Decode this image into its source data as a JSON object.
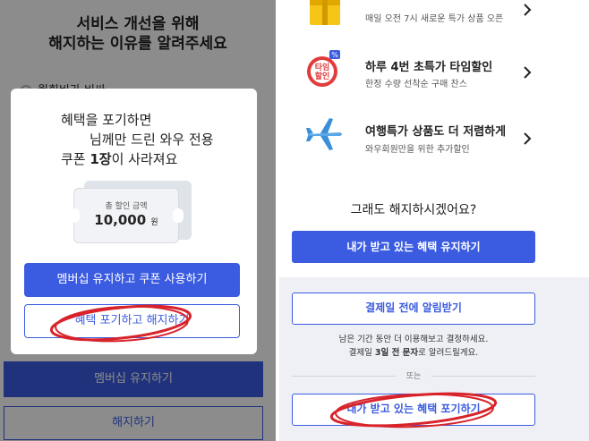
{
  "left": {
    "title_line1": "서비스 개선을 위해",
    "title_line2": "해지하는 이유를 알려주세요",
    "partial_option": "월회비가 비싸",
    "keep_membership": "멤버십 유지하기",
    "cancel": "해지하기",
    "modal": {
      "line1": "혜택을 포기하면",
      "line2": "님께만 드린 와우 전용",
      "line3_prefix": "쿠폰 ",
      "line3_bold": "1장",
      "line3_suffix": "이 사라져요",
      "coupon_label": "총 할인 금액",
      "coupon_amount": "10,000",
      "coupon_unit": "원",
      "primary_button": "멤버십 유지하고 쿠폰 사용하기",
      "secondary_button": "혜택 포기하고 해지하기"
    }
  },
  "right": {
    "benefits": [
      {
        "title": "",
        "desc": "매일 오전 7시 새로운 특가 상품 오픈",
        "icon": "gift-box-icon"
      },
      {
        "title": "하루 4번 초특가 타임할인",
        "desc": "한정 수량 선착순 구매 찬스",
        "icon": "time-sale-clock-icon",
        "badge": "타임\n할인"
      },
      {
        "title": "여행특가 상품도 더 저렴하게",
        "desc": "와우회원만을 위한 추가할인",
        "icon": "airplane-icon"
      }
    ],
    "question": "그래도 해지하시겠어요?",
    "keep_button": "내가 받고 있는 혜택 유지하기",
    "notify_button": "결제일 전에 알림받기",
    "info_line1": "남은 기간 동안 더 이용해보고 결정하세요.",
    "info_line2_prefix": "결제일 ",
    "info_line2_bold": "3일 전 문자",
    "info_line2_suffix": "로 알려드릴게요.",
    "or_label": "또는",
    "giveup_button": "내가 받고 있는 혜택 포기하기"
  },
  "colors": {
    "primary": "#3b5ce0",
    "annotation_circle": "#d8232a",
    "gray_bg": "#eef0f5"
  }
}
